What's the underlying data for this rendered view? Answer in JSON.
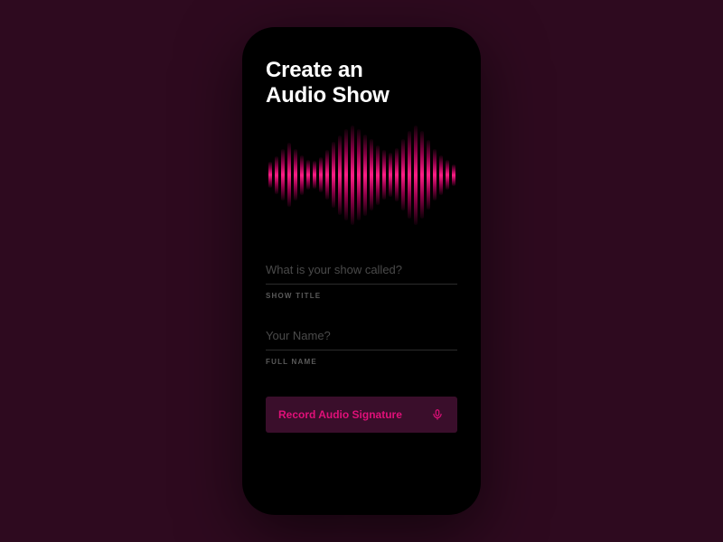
{
  "title_line1": "Create an",
  "title_line2": "Audio Show",
  "waveform": {
    "bars": [
      26,
      38,
      52,
      64,
      52,
      40,
      30,
      28,
      36,
      50,
      66,
      80,
      92,
      100,
      92,
      82,
      72,
      60,
      50,
      44,
      54,
      72,
      88,
      100,
      88,
      70,
      52,
      40,
      30,
      22
    ]
  },
  "form": {
    "show_title": {
      "placeholder": "What is your show called?",
      "label": "SHOW TITLE",
      "value": ""
    },
    "full_name": {
      "placeholder": "Your Name?",
      "label": "FULL NAME",
      "value": ""
    }
  },
  "actions": {
    "record_label": "Record Audio Signature"
  },
  "colors": {
    "accent": "#e01079"
  }
}
